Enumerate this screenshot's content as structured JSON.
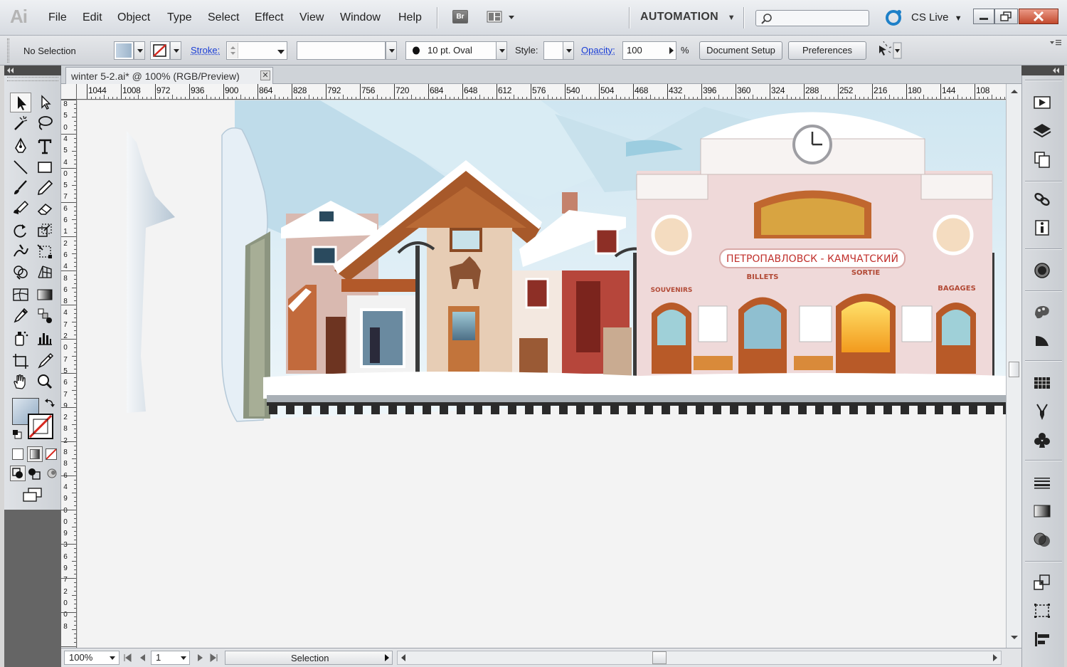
{
  "app": {
    "logo_text": "Ai"
  },
  "menu": [
    "File",
    "Edit",
    "Object",
    "Type",
    "Select",
    "Effect",
    "View",
    "Window",
    "Help"
  ],
  "menubar": {
    "bridge_label": "Br",
    "workspace": "AUTOMATION",
    "cs_live": "CS Live",
    "search_placeholder": ""
  },
  "control_bar": {
    "selection_status": "No Selection",
    "stroke_label": "Stroke:",
    "brush_label": "10 pt. Oval",
    "style_label": "Style:",
    "opacity_label": "Opacity:",
    "opacity_value": "100",
    "opacity_unit": "%",
    "document_setup": "Document Setup",
    "preferences": "Preferences"
  },
  "document": {
    "tab_title": "winter 5-2.ai* @ 100% (RGB/Preview)",
    "close_glyph": "✕"
  },
  "rulers": {
    "horizontal": [
      "1044",
      "1008",
      "972",
      "936",
      "900",
      "864",
      "828",
      "792",
      "756",
      "720",
      "684",
      "648",
      "612",
      "576",
      "540",
      "504",
      "468",
      "432",
      "396",
      "360",
      "324",
      "288",
      "252",
      "216",
      "180",
      "144",
      "108"
    ],
    "vertical": [
      "8",
      "5",
      "0",
      "4",
      "5",
      "4",
      "0",
      "5",
      "7",
      "6",
      "6",
      "1",
      "2",
      "6",
      "4",
      "8",
      "6",
      "8",
      "4",
      "7",
      "2",
      "0",
      "7",
      "5",
      "6",
      "7",
      "9",
      "2",
      "8",
      "2",
      "8",
      "8",
      "6",
      "4",
      "9",
      "0",
      "0",
      "9",
      "3",
      "6",
      "9",
      "7",
      "2",
      "0",
      "0",
      "8"
    ]
  },
  "artwork": {
    "sign_main": "ПЕТРОПАВЛОВСК - КАМЧАТСКИЙ",
    "sign_billets": "BILLETS",
    "sign_sortie": "SORTIE",
    "sign_souvenirs": "SOUVENIRS",
    "sign_bagages": "BAGAGES"
  },
  "status_bar": {
    "zoom": "100%",
    "artboard": "1",
    "tool_status": "Selection"
  },
  "colors": {
    "accent_link": "#1a3ed6",
    "station_pink": "#efd9d9",
    "sign_red": "#c0302c",
    "wood_brown": "#a95a2b",
    "snow": "#ffffff",
    "sky_blue": "#cfe4ef"
  },
  "icons": {
    "tools": [
      "selection-tool-icon",
      "direct-selection-tool-icon",
      "magic-wand-icon",
      "lasso-icon",
      "pen-tool-icon",
      "type-tool-icon",
      "line-tool-icon",
      "rectangle-tool-icon",
      "paintbrush-icon",
      "pencil-icon",
      "blob-brush-icon",
      "eraser-icon",
      "rotate-tool-icon",
      "scale-tool-icon",
      "warp-tool-icon",
      "free-transform-icon",
      "shape-builder-icon",
      "perspective-grid-icon",
      "mesh-tool-icon",
      "gradient-tool-icon",
      "eyedropper-icon",
      "blend-tool-icon",
      "symbol-sprayer-icon",
      "column-graph-icon",
      "artboard-tool-icon",
      "slice-tool-icon",
      "hand-tool-icon",
      "zoom-tool-icon"
    ],
    "dock": [
      "actions-icon",
      "layers-icon",
      "artboards-icon",
      "links-icon",
      "document-info-icon",
      "appearance-icon",
      "graphic-styles-icon",
      "color-guide-icon",
      "swatches-icon",
      "brushes-icon",
      "symbols-icon",
      "stroke-icon",
      "gradient-icon",
      "transparency-icon",
      "transform-icon",
      "align-icon",
      "pathfinder-icon"
    ]
  }
}
